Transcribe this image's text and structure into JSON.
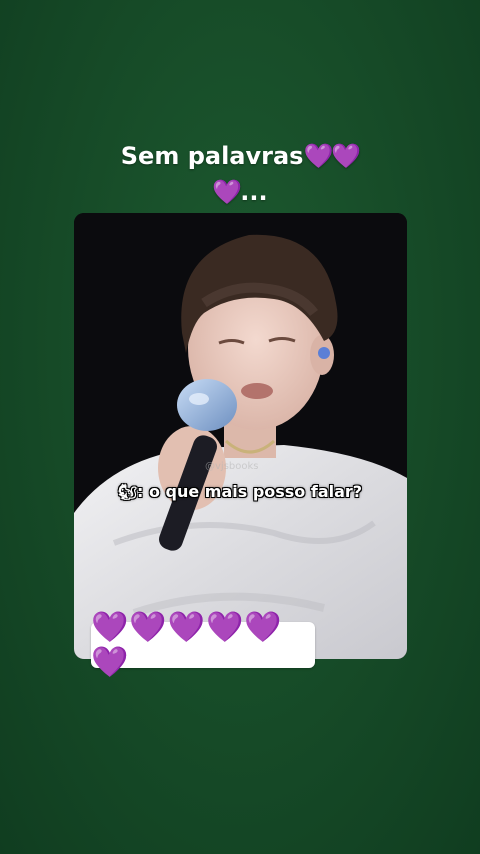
{
  "caption": {
    "text": "Sem palavras",
    "hearts_inline": "💜💜",
    "line2_heart": "💜",
    "line2_text": "..."
  },
  "video": {
    "subtitle_emoji": "🐿",
    "subtitle_text": ": o que mais posso falar?",
    "watermark": "@vjsbooks"
  },
  "hearts_sticker": {
    "text": "💜💜💜💜💜💜"
  },
  "colors": {
    "background": "#164a27",
    "heart": "#8e2bd8",
    "caption_text": "#ffffff"
  }
}
